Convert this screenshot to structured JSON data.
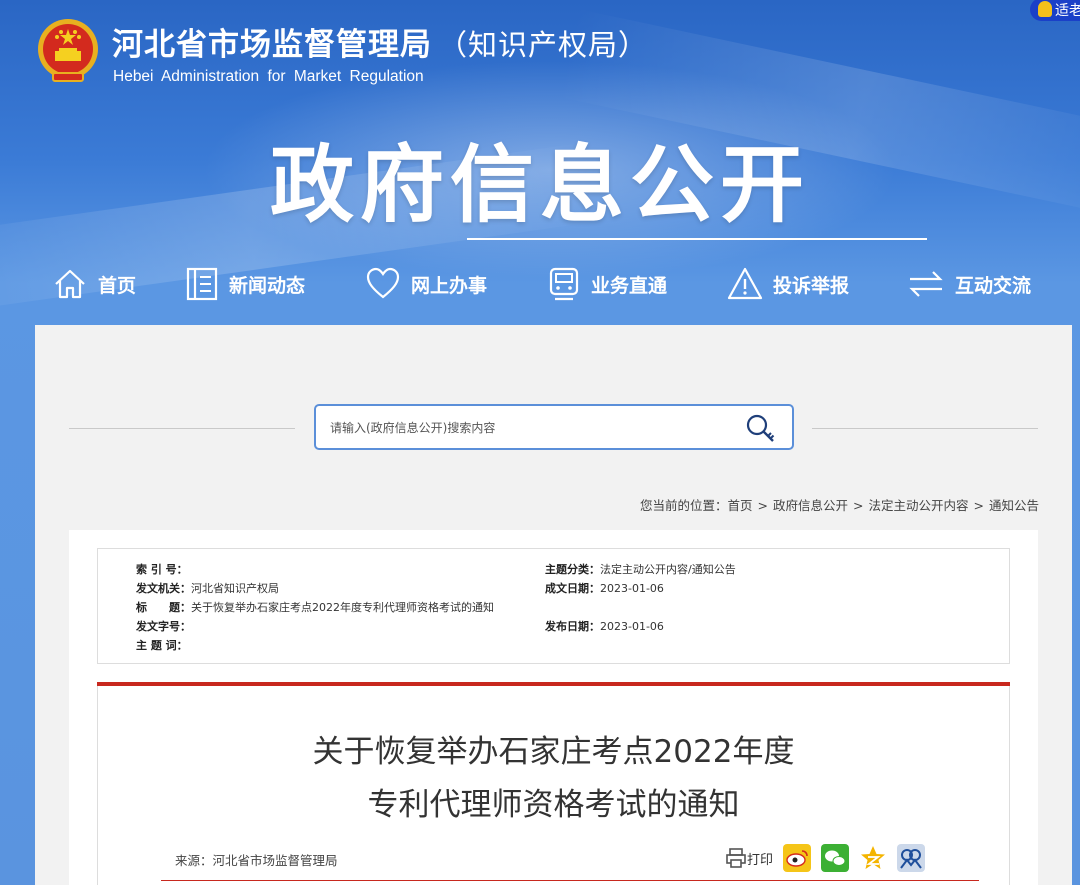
{
  "header": {
    "title_cn": "河北省市场监督管理局",
    "title_cn_sub": "（知识产权局）",
    "title_en": "Hebei Administration for Market Regulation",
    "elder_mode": "适老",
    "big_title": "政府信息公开"
  },
  "nav": [
    {
      "label": "首页",
      "icon": "home-icon"
    },
    {
      "label": "新闻动态",
      "icon": "news-icon"
    },
    {
      "label": "网上办事",
      "icon": "heart-icon"
    },
    {
      "label": "业务直通",
      "icon": "train-icon"
    },
    {
      "label": "投诉举报",
      "icon": "warning-icon"
    },
    {
      "label": "互动交流",
      "icon": "exchange-icon"
    }
  ],
  "search": {
    "placeholder": "请输入(政府信息公开)搜索内容"
  },
  "breadcrumb": {
    "prefix": "您当前的位置：",
    "items": [
      "首页",
      "政府信息公开",
      "法定主动公开内容",
      "通知公告"
    ],
    "separator": ">"
  },
  "meta": {
    "index_label": "索 引 号：",
    "index_value": "",
    "issuer_label": "发文机关：",
    "issuer_value": "河北省知识产权局",
    "title_label": "标　　题：",
    "title_value": "关于恢复举办石家庄考点2022年度专利代理师资格考试的通知",
    "docno_label": "发文字号：",
    "docno_value": "",
    "keywords_label": "主 题 词：",
    "keywords_value": "",
    "category_label": "主题分类：",
    "category_value": "法定主动公开内容/通知公告",
    "written_label": "成文日期：",
    "written_value": "2023-01-06",
    "published_label": "发布日期：",
    "published_value": "2023-01-06"
  },
  "article": {
    "title_line1": "关于恢复举办石家庄考点2022年度",
    "title_line2": "专利代理师资格考试的通知",
    "source": "来源：河北省市场监督管理局",
    "print_label": "打印",
    "share_icons": [
      "weibo-icon",
      "wechat-icon",
      "qzone-icon",
      "renren-icon"
    ]
  },
  "colors": {
    "header_blue": "#3b7bd6",
    "accent_red": "#c8281e",
    "search_border": "#5b8fd9"
  }
}
